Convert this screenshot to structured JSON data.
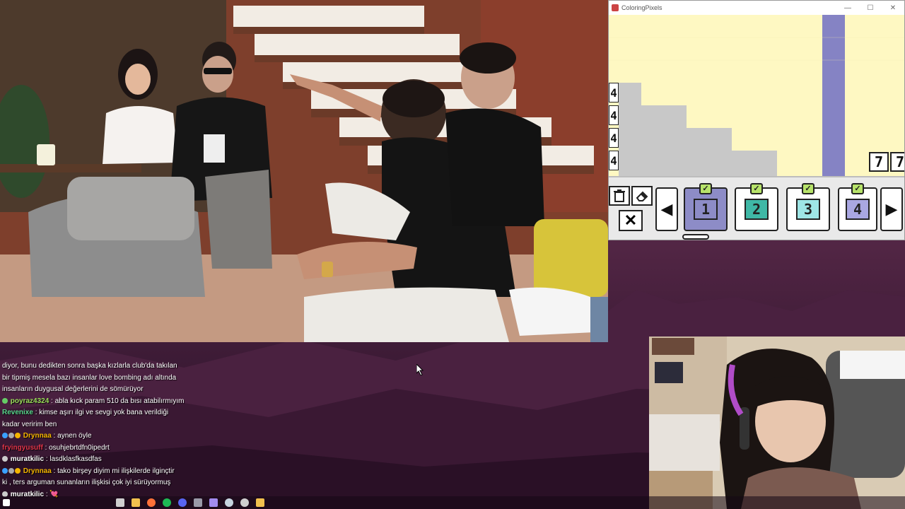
{
  "game": {
    "title": "ColoringPixels",
    "row_numbers": [
      "4",
      "4",
      "4",
      "4"
    ],
    "top_numbers": [
      "7",
      "7"
    ],
    "swatches": [
      {
        "number": "1",
        "color": "#8d8cc7",
        "selected": true,
        "done": true
      },
      {
        "number": "2",
        "color": "#3fb8a6",
        "selected": false,
        "done": true
      },
      {
        "number": "3",
        "color": "#9ee6e6",
        "selected": false,
        "done": true
      },
      {
        "number": "4",
        "color": "#a9a7e2",
        "selected": false,
        "done": true
      }
    ],
    "check_mark": "✓",
    "close_mark": "✕"
  },
  "chat": {
    "messages": [
      {
        "user": "",
        "text": "diyor, bunu dedikten sonra başka kızlarla club'da takılan",
        "user_color": "#ffffff",
        "badges": []
      },
      {
        "user": "",
        "text": "bir tipmiş mesela bazı insanlar love bombing adı altında",
        "user_color": "#ffffff",
        "badges": []
      },
      {
        "user": "",
        "text": "insanların duygusal değerlerini de sömürüyor",
        "user_color": "#ffffff",
        "badges": []
      },
      {
        "user": "poyraz4324",
        "text": ": abla kıck param 510 da bısı atabilırmıyım",
        "user_color": "#9be05a",
        "badges": [
          "#6c6"
        ]
      },
      {
        "user": "Revenixe",
        "text": ": kimse aşırı ilgi ve sevgi yok bana verildiği",
        "user_color": "#58d68d",
        "badges": []
      },
      {
        "user": "",
        "text": "kadar veririm ben",
        "user_color": "#ffffff",
        "badges": []
      },
      {
        "user": "Drynnaa",
        "text": ": aynen öyle",
        "user_color": "#f4b400",
        "badges": [
          "#3aa0ff",
          "#aaa",
          "#f4b400"
        ]
      },
      {
        "user": "fryingyusuff",
        "text": ": osuhjebrtdfn0ipedrt",
        "user_color": "#e0354a",
        "badges": []
      },
      {
        "user": "muratkilic",
        "text": ": lasdklasfkasdfas",
        "user_color": "#ffffff",
        "badges": [
          "#ccc"
        ]
      },
      {
        "user": "Drynnaa",
        "text": ": tako birşey diyim mi ilişkilerde ilginçtir",
        "user_color": "#f4b400",
        "badges": [
          "#3aa0ff",
          "#aaa",
          "#f4b400"
        ]
      },
      {
        "user": "",
        "text": "ki , ters arguman sunanların ilişkisi çok iyi sürüyormuş",
        "user_color": "#ffffff",
        "badges": []
      },
      {
        "user": "muratkilic",
        "text": ": 💘",
        "user_color": "#ffffff",
        "badges": [
          "#ccc"
        ]
      }
    ]
  },
  "taskbar": {
    "icons": [
      "search-icon",
      "task-view-icon",
      "file-explorer-icon",
      "firefox-icon",
      "spotify-icon",
      "discord-icon",
      "app-icon",
      "shield-icon",
      "steam-icon",
      "obs-icon",
      "notes-icon"
    ],
    "colors": [
      "#ffffff",
      "#cfcfcf",
      "#f2c14e",
      "#ff7139",
      "#1db954",
      "#5865f2",
      "#9a9aa8",
      "#a38cf0",
      "#c7d5e0",
      "#cfcfcf",
      "#f2c14e"
    ]
  }
}
